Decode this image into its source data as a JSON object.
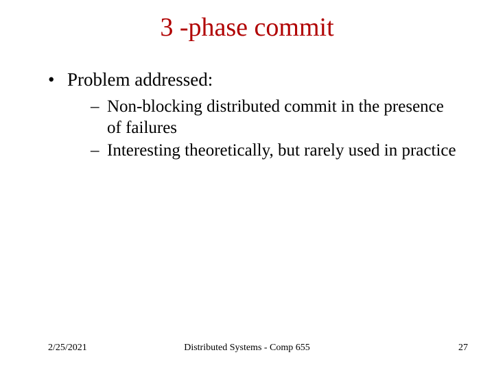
{
  "title": "3 -phase commit",
  "bullets": {
    "lvl1_0": "Problem addressed:",
    "lvl2_0": "Non-blocking distributed commit in the presence of failures",
    "lvl2_1": "Interesting theoretically, but rarely used in practice"
  },
  "footer": {
    "date": "2/25/2021",
    "center": "Distributed Systems - Comp 655",
    "page": "27"
  }
}
